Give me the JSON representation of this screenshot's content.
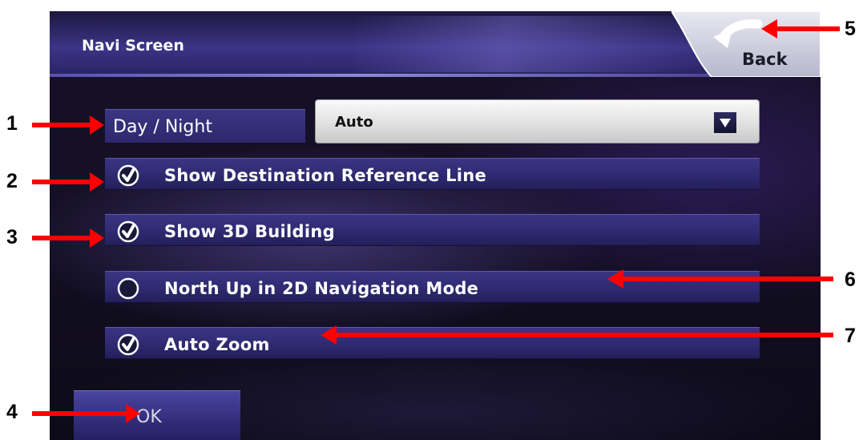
{
  "header": {
    "title": "Navi Screen",
    "back_label": "Back"
  },
  "day_night": {
    "label": "Day / Night",
    "value": "Auto"
  },
  "options": [
    {
      "label": "Show Destination Reference Line",
      "checked": true
    },
    {
      "label": "Show 3D Building",
      "checked": true
    },
    {
      "label": "North Up in 2D Navigation Mode",
      "checked": false
    },
    {
      "label": "Auto Zoom",
      "checked": true
    }
  ],
  "ok_label": "OK",
  "callouts": {
    "c1": "1",
    "c2": "2",
    "c3": "3",
    "c4": "4",
    "c5": "5",
    "c6": "6",
    "c7": "7"
  },
  "colors": {
    "callout_arrow": "#ff0000",
    "panel": "#2f2a70",
    "background": "#140f24"
  },
  "icons": {
    "check": "check-circle-icon",
    "back": "back-arrow-icon",
    "dropdown": "chevron-down-icon"
  }
}
